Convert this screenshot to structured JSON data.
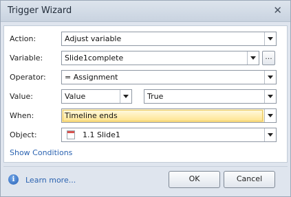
{
  "window": {
    "title": "Trigger Wizard"
  },
  "fields": {
    "action": {
      "label": "Action:",
      "value": "Adjust variable"
    },
    "variable": {
      "label": "Variable:",
      "value": "Slide1complete",
      "browse_label": "..."
    },
    "operator": {
      "label": "Operator:",
      "value": "= Assignment"
    },
    "value": {
      "label": "Value:",
      "type_value": "Value",
      "value": "True"
    },
    "when": {
      "label": "When:",
      "value": "Timeline ends"
    },
    "object": {
      "label": "Object:",
      "value": "1.1 Slide1"
    }
  },
  "links": {
    "show_conditions": "Show Conditions",
    "learn_more": "Learn more..."
  },
  "buttons": {
    "ok": "OK",
    "cancel": "Cancel"
  },
  "icons": {
    "close": "close-icon",
    "info": "info-icon",
    "object": "slide-thumbnail-icon",
    "dropdown": "chevron-down-icon"
  },
  "colors": {
    "highlight": "#ffe69c",
    "link": "#2a62b0",
    "dialog_bg": "#dfe5ee"
  }
}
